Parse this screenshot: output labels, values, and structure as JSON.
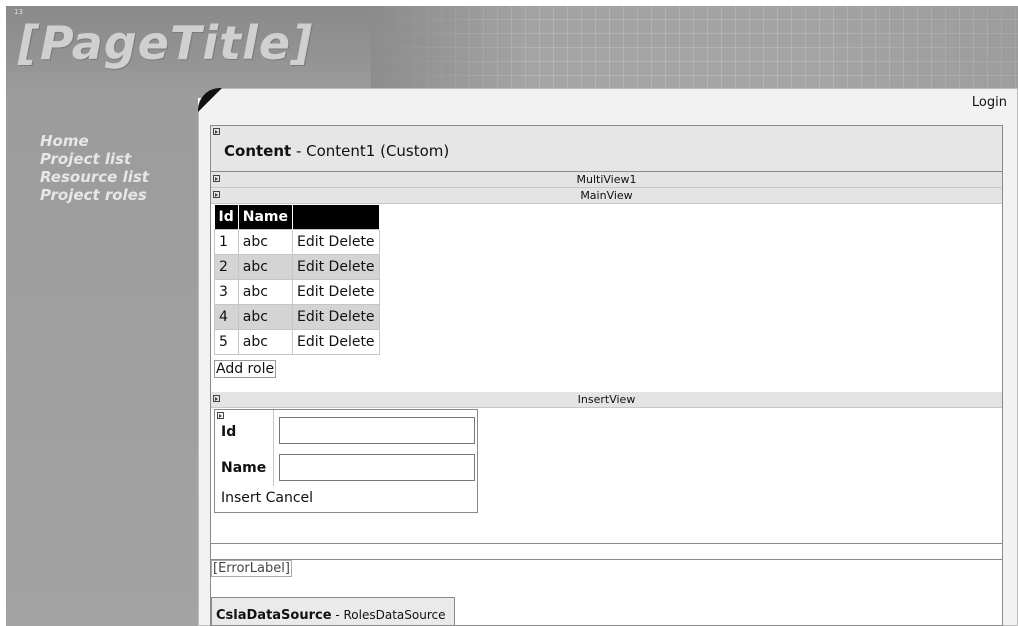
{
  "header": {
    "title": "[PageTitle]"
  },
  "nav": {
    "items": [
      {
        "label": "Home"
      },
      {
        "label": "Project list"
      },
      {
        "label": "Resource list"
      },
      {
        "label": "Project roles"
      }
    ]
  },
  "login": {
    "label": "Login"
  },
  "content": {
    "keyword": "Content",
    "rest": " - Content1 (Custom)"
  },
  "multiview": {
    "label": "MultiView1"
  },
  "mainview": {
    "label": "MainView"
  },
  "grid": {
    "headers": [
      "Id",
      "Name",
      ""
    ],
    "rows": [
      {
        "id": "1",
        "name": "abc",
        "actions": "Edit Delete"
      },
      {
        "id": "2",
        "name": "abc",
        "actions": "Edit Delete"
      },
      {
        "id": "3",
        "name": "abc",
        "actions": "Edit Delete"
      },
      {
        "id": "4",
        "name": "abc",
        "actions": "Edit Delete"
      },
      {
        "id": "5",
        "name": "abc",
        "actions": "Edit Delete"
      }
    ]
  },
  "add_role": {
    "label": "Add role"
  },
  "insertview": {
    "label": "InsertView"
  },
  "insert_form": {
    "id_label": "Id",
    "name_label": "Name",
    "actions": "Insert Cancel"
  },
  "error_label": {
    "text": "[ErrorLabel]"
  },
  "datasource": {
    "keyword": "CslaDataSource",
    "rest": " - RolesDataSource"
  },
  "colors": {
    "header_bg": "#939393",
    "nav_bg": "#a0a0a0",
    "grid_header": "#000000",
    "alt_row": "#d4d4d4"
  }
}
